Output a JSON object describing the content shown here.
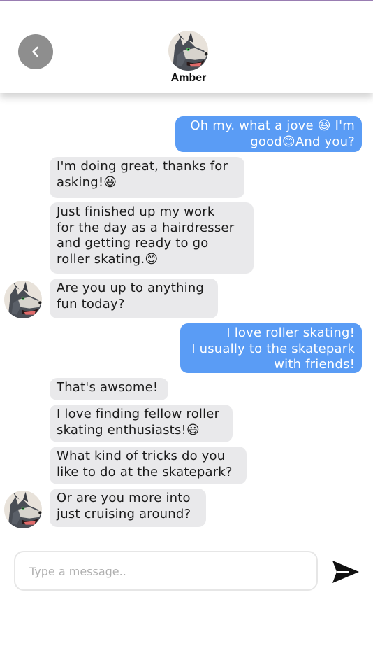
{
  "header": {
    "contact_name": "Amber",
    "back_icon": "chevron-left-icon",
    "avatar_icon": "wolf-avatar-icon"
  },
  "messages": [
    {
      "sender": "me",
      "lines": [
        "Oh my. what a jove 😆 I'm",
        "good😊And you?"
      ]
    },
    {
      "sender": "amber",
      "lines": [
        "I'm doing great, thanks for",
        "asking!😃"
      ]
    },
    {
      "sender": "amber",
      "lines": [
        "Just finished up my work",
        "for the day as a hairdresser",
        "and getting ready to go",
        "roller skating.😊"
      ]
    },
    {
      "sender": "amber",
      "lines": [
        "Are you up to anything",
        "fun today?"
      ]
    },
    {
      "sender": "me",
      "lines": [
        "I love roller skating!",
        "I usually to the skatepark",
        "with friends!"
      ]
    },
    {
      "sender": "amber",
      "lines": [
        "That's awsome!"
      ]
    },
    {
      "sender": "amber",
      "lines": [
        "I love finding fellow roller",
        "skating enthusiasts!😃"
      ]
    },
    {
      "sender": "amber",
      "lines": [
        "What kind of tricks do you",
        "like to do at the skatepark?"
      ]
    },
    {
      "sender": "amber",
      "lines": [
        "Or are you more into",
        "just cruising around?"
      ]
    }
  ],
  "composer": {
    "placeholder": "Type a message..",
    "value": "",
    "send_icon": "send-icon"
  },
  "colors": {
    "outgoing_bubble": "#5a9cf5",
    "incoming_bubble": "#e9e9eb",
    "back_button": "#8e8e8e"
  }
}
